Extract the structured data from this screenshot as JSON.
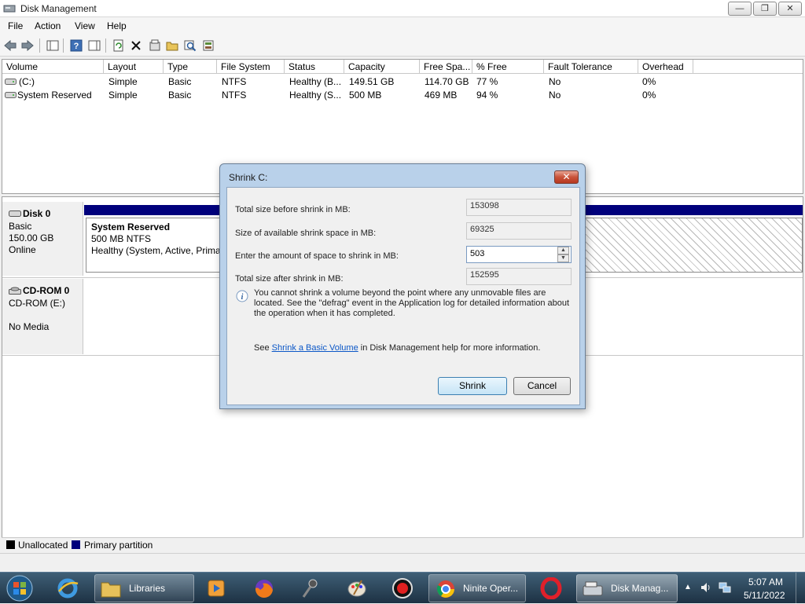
{
  "window": {
    "title": "Disk Management",
    "min": "—",
    "max": "❐",
    "close": "✕"
  },
  "menu": [
    "File",
    "Action",
    "View",
    "Help"
  ],
  "columns": [
    "Volume",
    "Layout",
    "Type",
    "File System",
    "Status",
    "Capacity",
    "Free Spa...",
    "% Free",
    "Fault Tolerance",
    "Overhead"
  ],
  "volumes": [
    {
      "volume": "(C:)",
      "layout": "Simple",
      "type": "Basic",
      "fs": "NTFS",
      "status": "Healthy (B...",
      "capacity": "149.51 GB",
      "free": "114.70 GB",
      "pct": "77 %",
      "fault": "No",
      "overhead": "0%"
    },
    {
      "volume": "System Reserved",
      "layout": "Simple",
      "type": "Basic",
      "fs": "NTFS",
      "status": "Healthy (S...",
      "capacity": "500 MB",
      "free": "469 MB",
      "pct": "94 %",
      "fault": "No",
      "overhead": "0%"
    }
  ],
  "disk0": {
    "name": "Disk 0",
    "type": "Basic",
    "size": "150.00 GB",
    "state": "Online",
    "part_title": "System Reserved",
    "part_size": "500 MB NTFS",
    "part_status": "Healthy (System, Active, Primar"
  },
  "cdrom0": {
    "name": "CD-ROM 0",
    "drive": "CD-ROM (E:)",
    "media": "No Media"
  },
  "legend": {
    "unallocated": "Unallocated",
    "primary": "Primary partition"
  },
  "dialog": {
    "title": "Shrink C:",
    "close": "✕",
    "total_before_label": "Total size before shrink in MB:",
    "total_before": "153098",
    "available_label": "Size of available shrink space in MB:",
    "available": "69325",
    "amount_label": "Enter the amount of space to shrink in MB:",
    "amount": "503",
    "after_label": "Total size after shrink in MB:",
    "after": "152595",
    "info": "You cannot shrink a volume beyond the point where any unmovable files are located. See the \"defrag\" event in the Application log for detailed information about the operation when it has completed.",
    "see_prefix": "See ",
    "see_link": "Shrink a Basic Volume",
    "see_suffix": " in Disk Management help for more information.",
    "shrink": "Shrink",
    "cancel": "Cancel"
  },
  "taskbar": {
    "libraries": "Libraries",
    "ninite": "Ninite Oper...",
    "diskmgmt": "Disk Manag...",
    "time": "5:07 AM",
    "date": "5/11/2022"
  },
  "colors": {
    "navy": "#00007c",
    "accent": "#3c7fb1"
  }
}
